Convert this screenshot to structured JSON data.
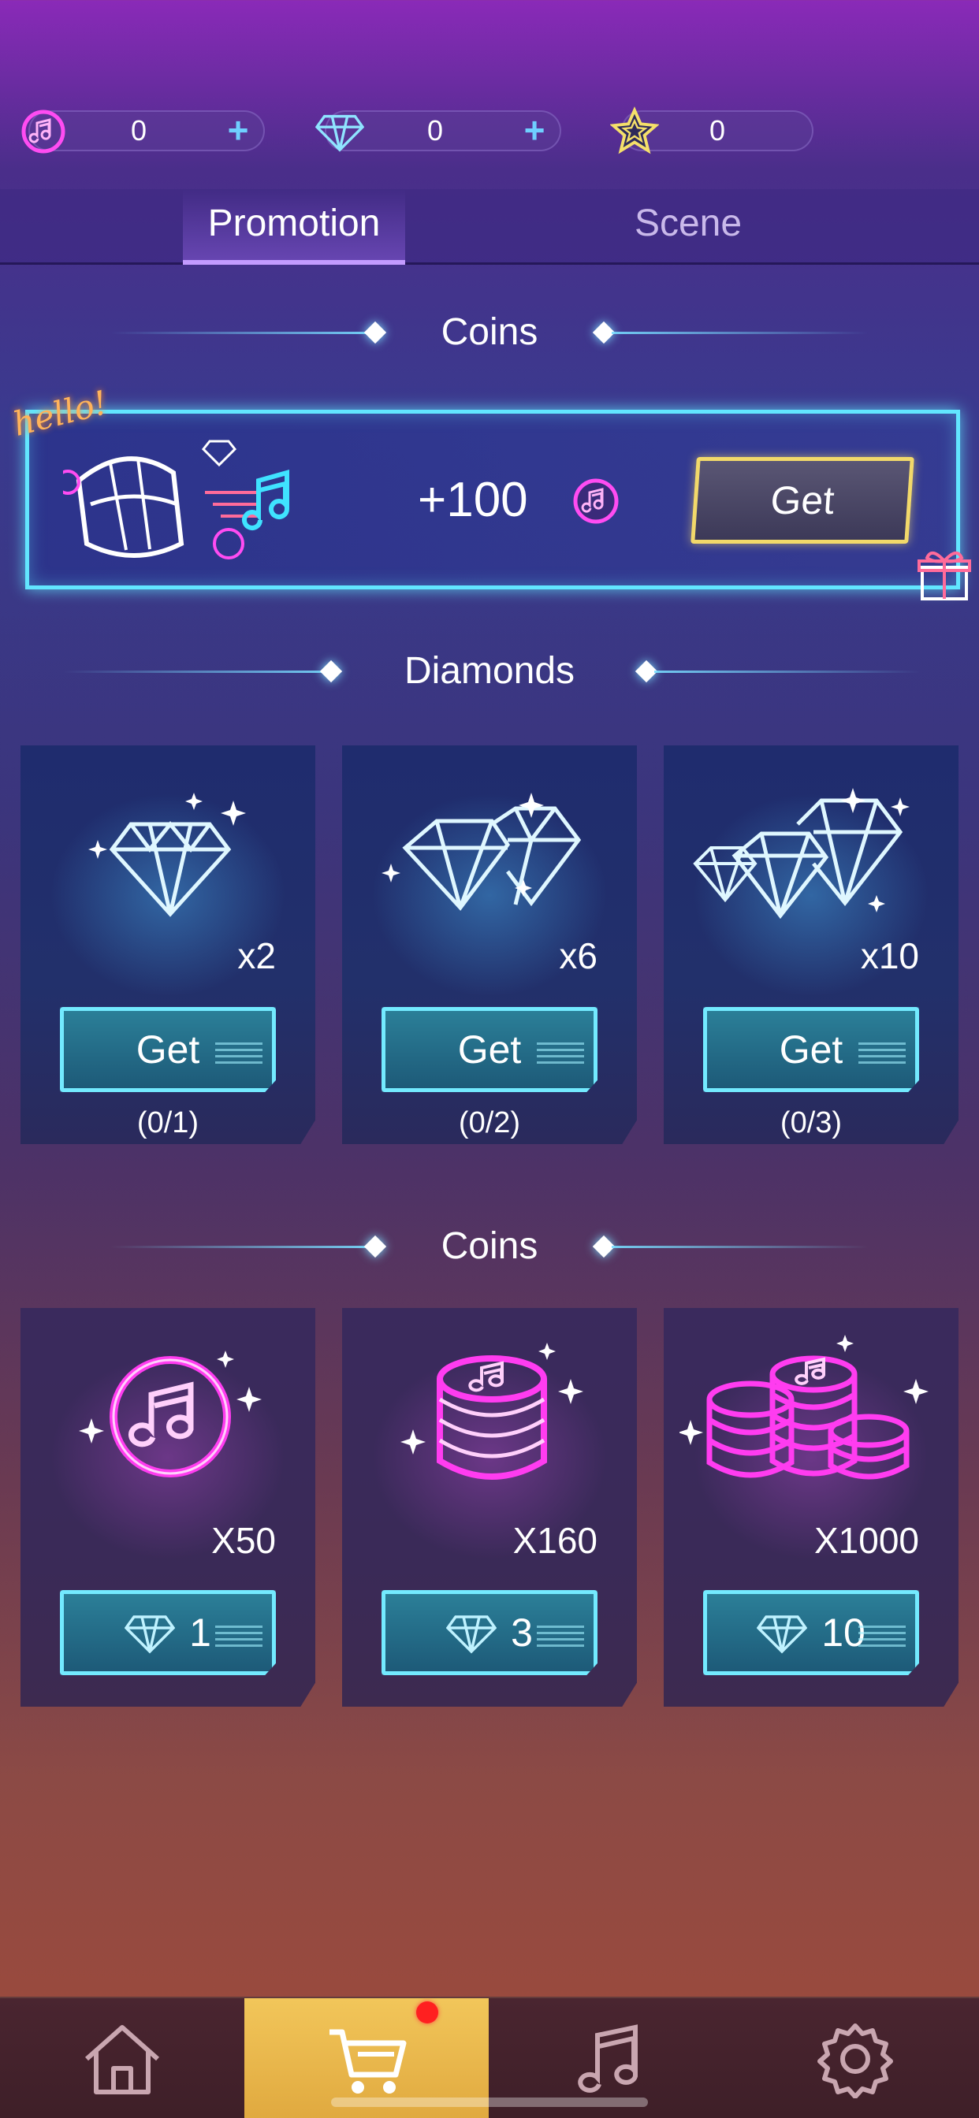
{
  "stats": {
    "music_coins": "0",
    "diamonds": "0",
    "stars": "0",
    "plus_symbol": "+"
  },
  "tabs": [
    {
      "label": "Promotion",
      "active": true
    },
    {
      "label": "Scene",
      "active": false
    }
  ],
  "sections": {
    "coins_top": "Coins",
    "diamonds": "Diamonds",
    "coins_bottom": "Coins"
  },
  "banner": {
    "hello": "hello!",
    "amount": "+100",
    "get_label": "Get"
  },
  "diamond_offers": [
    {
      "qty": "x2",
      "button": "Get",
      "limit": "(0/1)"
    },
    {
      "qty": "x6",
      "button": "Get",
      "limit": "(0/2)"
    },
    {
      "qty": "x10",
      "button": "Get",
      "limit": "(0/3)"
    }
  ],
  "coin_offers": [
    {
      "qty": "X50",
      "price": "1"
    },
    {
      "qty": "X160",
      "price": "3"
    },
    {
      "qty": "X1000",
      "price": "10"
    }
  ],
  "nav": [
    {
      "icon": "home-icon",
      "active": false
    },
    {
      "icon": "cart-icon",
      "active": true
    },
    {
      "icon": "music-note-icon",
      "active": false
    },
    {
      "icon": "settings-gear-icon",
      "active": false
    }
  ],
  "colors": {
    "neon_cyan": "#62e6ff",
    "neon_pink": "#ff3cf0",
    "gold": "#f2d96a",
    "active_nav": "#f2c65a"
  }
}
